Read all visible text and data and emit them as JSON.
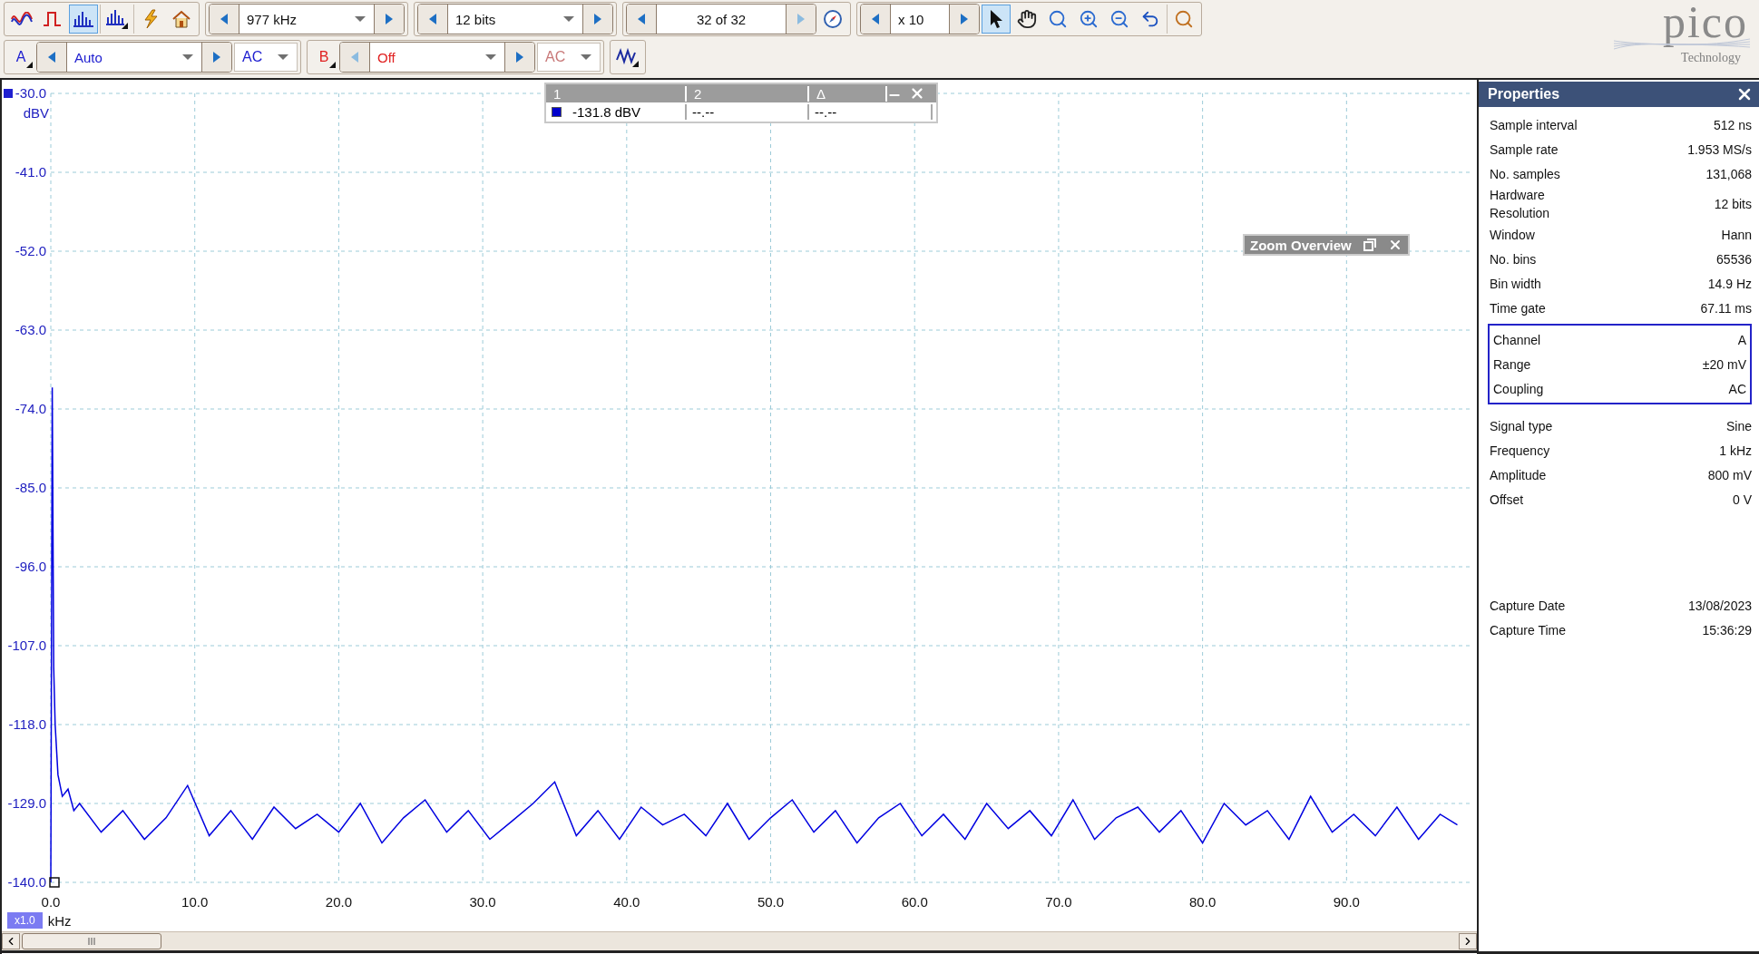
{
  "toolbar": {
    "view_modes": [
      {
        "kind": "scope",
        "selected": false
      },
      {
        "kind": "persistence",
        "selected": false
      },
      {
        "kind": "spectrum",
        "selected": true
      },
      {
        "kind": "spectrum_options",
        "selected": false
      }
    ],
    "actions": [
      {
        "kind": "trigger"
      },
      {
        "kind": "home"
      }
    ],
    "spinners": [
      {
        "kind": "dropdown",
        "value": "977 kHz",
        "next_disabled": false
      },
      {
        "kind": "dropdown",
        "value": "12 bits",
        "next_disabled": false
      },
      {
        "kind": "counter",
        "value": "32 of 32",
        "next_disabled": true
      }
    ],
    "zoom_spinner": {
      "value": "x 10"
    },
    "tools": [
      {
        "kind": "pointer",
        "selected": true
      },
      {
        "kind": "hand",
        "selected": false
      },
      {
        "kind": "zoom_fit",
        "selected": false
      },
      {
        "kind": "zoom_in",
        "selected": false
      },
      {
        "kind": "zoom_out",
        "selected": false
      },
      {
        "kind": "undo",
        "selected": false
      },
      {
        "kind": "zoom_100",
        "selected": false
      }
    ]
  },
  "channels": [
    {
      "name": "A",
      "color": "#2020d0",
      "range": "Auto",
      "coupling": "AC",
      "enabled": true
    },
    {
      "name": "B",
      "color": "#e02020",
      "range": "Off",
      "coupling": "AC",
      "enabled": false
    }
  ],
  "logo": {
    "brand": "pico",
    "tagline": "Technology"
  },
  "chart": {
    "x_multiplier": "x1.0",
    "chart_data": {
      "type": "line",
      "grid": true,
      "xlabel": "kHz",
      "ylabel": "dBV",
      "xlim": [
        0,
        98.8
      ],
      "ylim": [
        -140,
        -30
      ],
      "xticks": [
        {
          "value": 0,
          "label": "0.0"
        },
        {
          "value": 10,
          "label": "10.0"
        },
        {
          "value": 20,
          "label": "20.0"
        },
        {
          "value": 30,
          "label": "30.0"
        },
        {
          "value": 40,
          "label": "40.0"
        },
        {
          "value": 50,
          "label": "50.0"
        },
        {
          "value": 60,
          "label": "60.0"
        },
        {
          "value": 70,
          "label": "70.0"
        },
        {
          "value": 80,
          "label": "80.0"
        },
        {
          "value": 90,
          "label": "90.0"
        }
      ],
      "yticks": [
        {
          "value": -30,
          "label": "-30.0"
        },
        {
          "value": -41,
          "label": "-41.0"
        },
        {
          "value": -52,
          "label": "-52.0"
        },
        {
          "value": -63,
          "label": "-63.0"
        },
        {
          "value": -74,
          "label": "-74.0"
        },
        {
          "value": -85,
          "label": "-85.0"
        },
        {
          "value": -96,
          "label": "-96.0"
        },
        {
          "value": -107,
          "label": "-107.0"
        },
        {
          "value": -118,
          "label": "-118.0"
        },
        {
          "value": -129,
          "label": "-129.0"
        },
        {
          "value": -140,
          "label": "-140.0"
        }
      ],
      "x": [
        0,
        0.1,
        0.2,
        0.3,
        0.5,
        0.8,
        1.2,
        1.6,
        2.0,
        3.5,
        5.0,
        6.5,
        8.0,
        9.5,
        11.0,
        12.5,
        14.0,
        15.5,
        17.0,
        18.5,
        20.0,
        21.5,
        23.0,
        24.5,
        26.0,
        27.5,
        29.0,
        30.5,
        32.0,
        33.5,
        35.0,
        36.5,
        38.0,
        39.5,
        41.0,
        42.5,
        44.0,
        45.5,
        47.0,
        48.5,
        50.0,
        51.5,
        53.0,
        54.5,
        56.0,
        57.5,
        59.0,
        60.5,
        62.0,
        63.5,
        65.0,
        66.5,
        68.0,
        69.5,
        71.0,
        72.5,
        74.0,
        75.5,
        77.0,
        78.5,
        80.0,
        81.5,
        83.0,
        84.5,
        86.0,
        87.5,
        89.0,
        90.5,
        92.0,
        93.5,
        95.0,
        96.5,
        97.7
      ],
      "series": [
        {
          "color": "#0000e0",
          "values": [
            -140,
            -71,
            -110,
            -118,
            -125,
            -128,
            -127,
            -130,
            -129,
            -133,
            -130,
            -134,
            -131,
            -126.5,
            -133.5,
            -130,
            -134,
            -129.5,
            -132.5,
            -130.5,
            -133,
            -129,
            -134.5,
            -131,
            -128.5,
            -133,
            -130,
            -134,
            -131.5,
            -129,
            -126,
            -133.5,
            -130,
            -134,
            -129.5,
            -132,
            -130.5,
            -133.5,
            -129,
            -134,
            -131,
            -128.5,
            -133,
            -130,
            -134.5,
            -131,
            -129,
            -133.5,
            -130.5,
            -134,
            -129,
            -132.5,
            -130,
            -133.5,
            -128.5,
            -134,
            -131,
            -129.5,
            -133,
            -130,
            -134.5,
            -129,
            -132,
            -130,
            -134,
            -128,
            -133,
            -130.5,
            -133.5,
            -129.5,
            -134,
            -130.5,
            -132
          ]
        }
      ]
    }
  },
  "measurements": {
    "columns": [
      "1",
      "2",
      "Δ"
    ],
    "rows": [
      {
        "color": "#0000cc",
        "values": [
          "-131.8 dBV",
          "--.--",
          "--.--"
        ]
      }
    ]
  },
  "zoom_overview": {
    "title": "Zoom Overview"
  },
  "properties": {
    "title": "Properties",
    "sections": [
      {
        "kind": "plain",
        "rows": [
          {
            "label": "Sample interval",
            "value": "512 ns"
          },
          {
            "label": "Sample rate",
            "value": "1.953 MS/s"
          },
          {
            "label": "No. samples",
            "value": "131,068"
          },
          {
            "label": "Hardware Resolution",
            "value": "12 bits"
          },
          {
            "label": "Window",
            "value": "Hann"
          },
          {
            "label": "No. bins",
            "value": "65536"
          },
          {
            "label": "Bin width",
            "value": "14.9 Hz"
          },
          {
            "label": "Time gate",
            "value": "67.11 ms"
          }
        ]
      },
      {
        "kind": "boxed",
        "rows": [
          {
            "label": "Channel",
            "value": "A"
          },
          {
            "label": "Range",
            "value": "±20 mV"
          },
          {
            "label": "Coupling",
            "value": "AC"
          }
        ]
      },
      {
        "kind": "plain",
        "rows": [
          {
            "label": "Signal type",
            "value": "Sine"
          },
          {
            "label": "Frequency",
            "value": "1 kHz"
          },
          {
            "label": "Amplitude",
            "value": "800 mV"
          },
          {
            "label": "Offset",
            "value": "0 V"
          }
        ]
      },
      {
        "kind": "footer",
        "rows": [
          {
            "label": "Capture Date",
            "value": "13/08/2023"
          },
          {
            "label": "Capture Time",
            "value": "15:36:29"
          }
        ]
      }
    ]
  }
}
